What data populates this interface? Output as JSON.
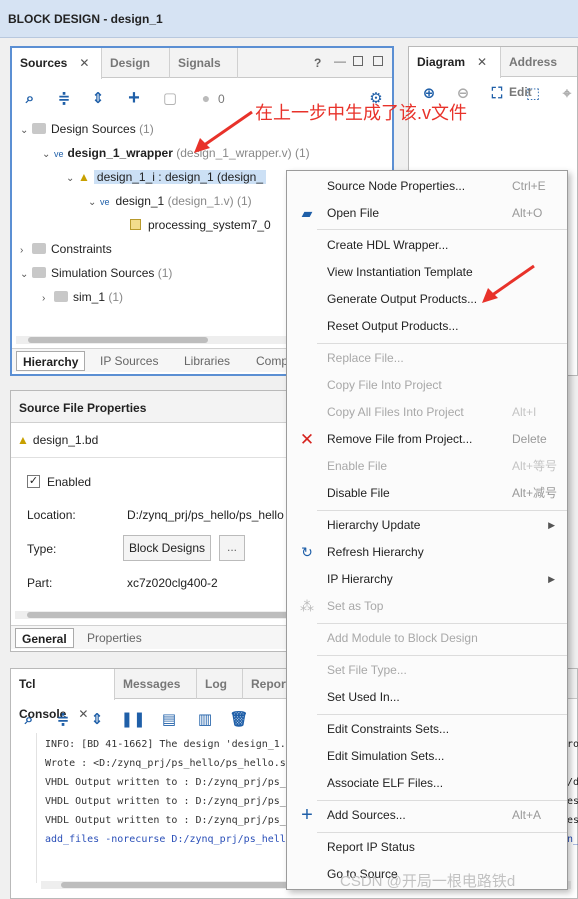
{
  "window": {
    "title": "BLOCK DESIGN - design_1"
  },
  "sources_panel": {
    "tabs": [
      "Sources",
      "Design",
      "Signals"
    ],
    "active_tab": "Sources",
    "badge_count": "0",
    "tree": [
      {
        "label": "Design Sources",
        "suffix": "(1)"
      },
      {
        "label": "design_1_wrapper",
        "suffix": "(design_1_wrapper.v) (1)"
      },
      {
        "label": "design_1_i : design_1 (design_"
      },
      {
        "label": "design_1",
        "suffix": "(design_1.v) (1)"
      },
      {
        "label": "processing_system7_0"
      },
      {
        "label": "Constraints"
      },
      {
        "label": "Simulation Sources",
        "suffix": "(1)"
      },
      {
        "label": "sim_1",
        "suffix": "(1)"
      }
    ],
    "bottom_tabs": [
      "Hierarchy",
      "IP Sources",
      "Libraries",
      "Comp"
    ]
  },
  "diagram_panel": {
    "tabs": [
      "Diagram",
      "Address Edit"
    ]
  },
  "annotation_text": "在上一步中生成了该.v文件",
  "properties_panel": {
    "title": "Source File Properties",
    "file": "design_1.bd",
    "enabled_label": "Enabled",
    "location_label": "Location:",
    "location_value": "D:/zynq_prj/ps_hello/ps_hello",
    "type_label": "Type:",
    "type_value": "Block Designs",
    "type_more": "...",
    "part_label": "Part:",
    "part_value": "xc7z020clg400-2",
    "bottom_tabs": [
      "General",
      "Properties"
    ]
  },
  "console_panel": {
    "tabs": [
      "Tcl Console",
      "Messages",
      "Log",
      "Report"
    ],
    "lines": [
      "INFO: [BD 41-1662] The design 'design_1.b",
      "Wrote  : <D:/zynq_prj/ps_hello/ps_hello.s",
      "VHDL Output written to : D:/zynq_prj/ps_h",
      "VHDL Output written to : D:/zynq_prj/ps_h",
      "VHDL Output written to : D:/zynq_prj/ps_h",
      "add_files -norecurse D:/zynq_prj/ps_hell"
    ],
    "right_fragments": [
      "ro",
      "/d",
      "es",
      "es",
      "n_",
      "es"
    ]
  },
  "context_menu": {
    "items": [
      {
        "label": "Source Node Properties...",
        "shortcut": "Ctrl+E"
      },
      {
        "label": "Open File",
        "shortcut": "Alt+O"
      },
      {
        "label": "Create HDL Wrapper..."
      },
      {
        "label": "View Instantiation Template"
      },
      {
        "label": "Generate Output Products..."
      },
      {
        "label": "Reset Output Products..."
      },
      {
        "label": "Replace File..."
      },
      {
        "label": "Copy File Into Project"
      },
      {
        "label": "Copy All Files Into Project",
        "shortcut": "Alt+I"
      },
      {
        "label": "Remove File from Project...",
        "shortcut": "Delete"
      },
      {
        "label": "Enable File",
        "shortcut": "Alt+等号"
      },
      {
        "label": "Disable File",
        "shortcut": "Alt+减号"
      },
      {
        "label": "Hierarchy Update"
      },
      {
        "label": "Refresh Hierarchy"
      },
      {
        "label": "IP Hierarchy"
      },
      {
        "label": "Set as Top"
      },
      {
        "label": "Add Module to Block Design"
      },
      {
        "label": "Set File Type..."
      },
      {
        "label": "Set Used In..."
      },
      {
        "label": "Edit Constraints Sets..."
      },
      {
        "label": "Edit Simulation Sets..."
      },
      {
        "label": "Associate ELF Files..."
      },
      {
        "label": "Add Sources...",
        "shortcut": "Alt+A"
      },
      {
        "label": "Report IP Status"
      },
      {
        "label": "Go to Source"
      }
    ]
  },
  "watermark": "CSDN @开局一根电路铁d",
  "colors": {
    "title_bg": "#d6e3f3",
    "accent_blue": "#1f5fa8",
    "annotation_red": "#e8322a",
    "selection": "#cce0f5"
  }
}
